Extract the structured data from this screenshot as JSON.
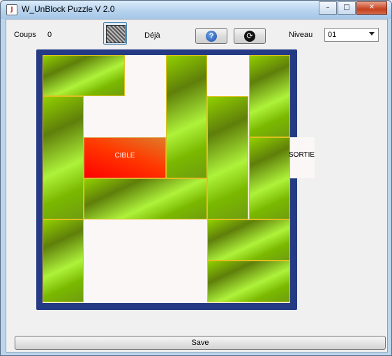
{
  "window": {
    "title": "W_UnBlock Puzzle V 2.0",
    "buttons": {
      "minimize": "–",
      "maximize": "□",
      "close": "✕"
    }
  },
  "toolbar": {
    "coups_label": "Coups",
    "coups_value": "0",
    "deja_label": "Déjà",
    "help_symbol": "?",
    "refresh_symbol": "⟳",
    "niveau_label": "Niveau",
    "niveau_value": "01"
  },
  "board": {
    "target_label": "CIBLE",
    "exit_label": "SORTIE",
    "colors": {
      "frame": "#243a85",
      "floor": "#fbf7f6",
      "target": "#ff2200",
      "block": "#8fcc00"
    }
  },
  "footer": {
    "save_label": "Save"
  },
  "icons": [
    "app-icon",
    "puzzle-thumbnail-icon",
    "help-icon",
    "refresh-icon",
    "dropdown-arrow-icon"
  ]
}
